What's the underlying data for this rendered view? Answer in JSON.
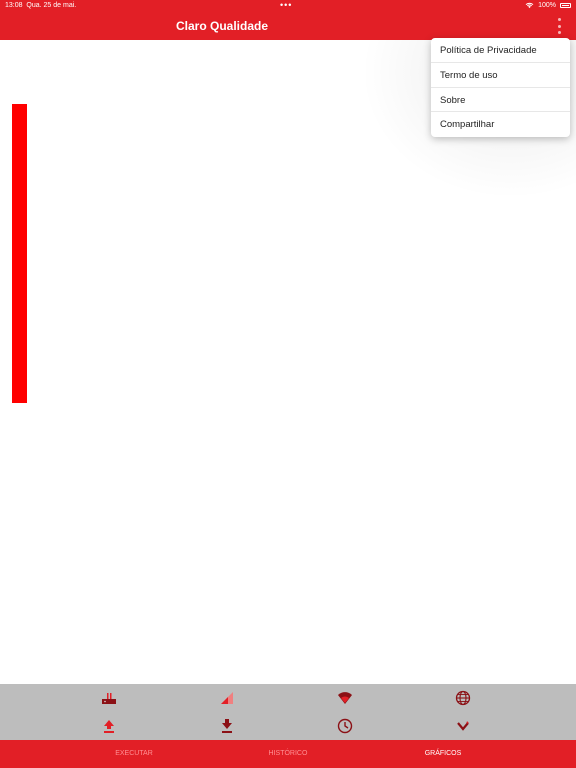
{
  "status_bar": {
    "time": "13:08",
    "date": "Qua. 25 de mai.",
    "dots": "•••",
    "battery": "100%"
  },
  "header": {
    "title": "Claro Qualidade"
  },
  "menu": {
    "items": [
      {
        "label": "Política de Privacidade"
      },
      {
        "label": "Termo de uso"
      },
      {
        "label": "Sobre"
      },
      {
        "label": "Compartilhar"
      }
    ]
  },
  "toolbar": {
    "icons": [
      "router-icon",
      "signal-icon",
      "wifi-icon",
      "globe-icon",
      "upload-icon",
      "download-icon",
      "clock-icon",
      "chevron-down-icon"
    ]
  },
  "tabs": [
    {
      "label": "EXECUTAR"
    },
    {
      "label": "HISTÓRICO"
    },
    {
      "label": "GRÁFICOS"
    }
  ],
  "colors": {
    "brand_red": "#e21f26",
    "bar_red": "#ff0000",
    "toolbar_gray": "#bdbdbd"
  }
}
